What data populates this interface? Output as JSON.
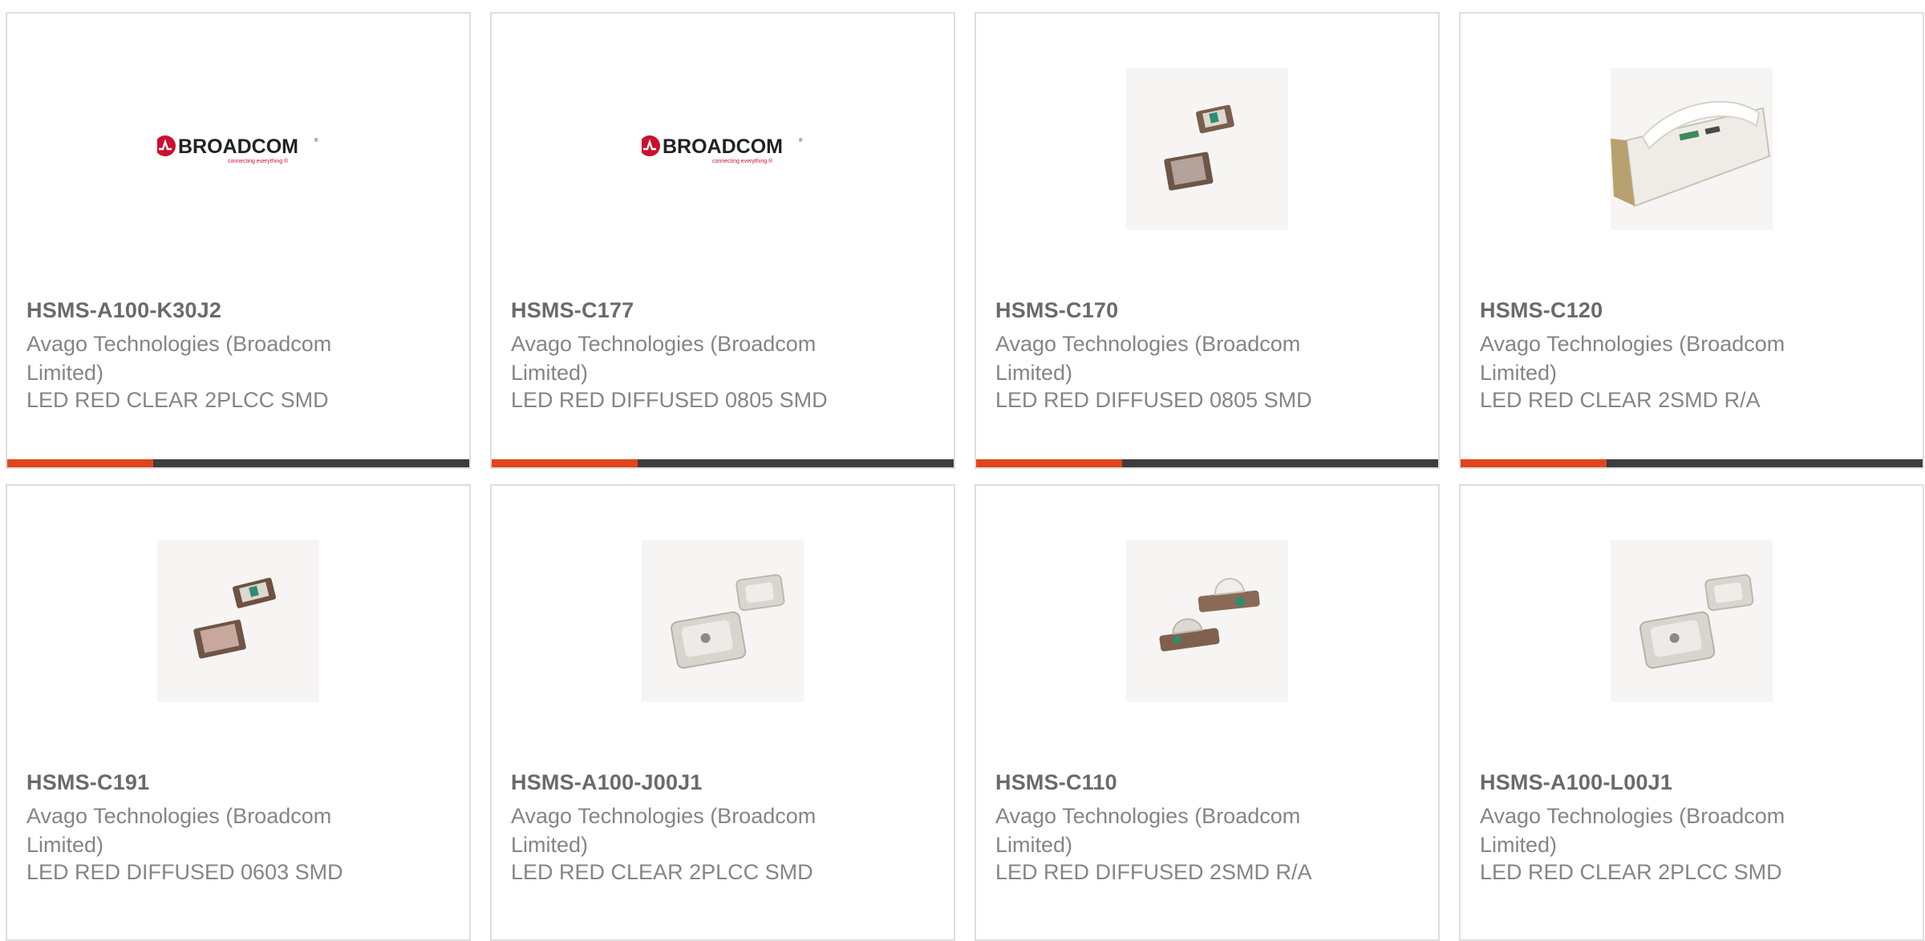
{
  "colors": {
    "accent": "#e1451c",
    "bar_dark": "#3d3d3d",
    "title": "#6a6a6a",
    "text": "#858585",
    "border": "#dedede",
    "broadcom_red": "#cc0f2f"
  },
  "logo": {
    "name": "BROADCOM",
    "trademark": "®",
    "tagline": "connecting everything ®"
  },
  "products": [
    {
      "part": "HSMS-A100-K30J2",
      "manufacturer": "Avago Technologies (Broadcom Limited)",
      "description": "LED RED CLEAR 2PLCC SMD",
      "image": "broadcom-logo"
    },
    {
      "part": "HSMS-C177",
      "manufacturer": "Avago Technologies (Broadcom Limited)",
      "description": "LED RED DIFFUSED 0805 SMD",
      "image": "broadcom-logo"
    },
    {
      "part": "HSMS-C170",
      "manufacturer": "Avago Technologies (Broadcom Limited)",
      "description": "LED RED DIFFUSED 0805 SMD",
      "image": "smd-led-0805-photo"
    },
    {
      "part": "HSMS-C120",
      "manufacturer": "Avago Technologies (Broadcom Limited)",
      "description": "LED RED CLEAR 2SMD R/A",
      "image": "right-angle-led-photo"
    },
    {
      "part": "HSMS-C191",
      "manufacturer": "Avago Technologies (Broadcom Limited)",
      "description": "LED RED DIFFUSED 0603 SMD",
      "image": "smd-led-0603-photo"
    },
    {
      "part": "HSMS-A100-J00J1",
      "manufacturer": "Avago Technologies (Broadcom Limited)",
      "description": "LED RED CLEAR 2PLCC SMD",
      "image": "plcc-led-photo"
    },
    {
      "part": "HSMS-C110",
      "manufacturer": "Avago Technologies (Broadcom Limited)",
      "description": "LED RED DIFFUSED 2SMD R/A",
      "image": "dome-led-photo"
    },
    {
      "part": "HSMS-A100-L00J1",
      "manufacturer": "Avago Technologies (Broadcom Limited)",
      "description": "LED RED CLEAR 2PLCC SMD",
      "image": "plcc-led-photo"
    }
  ]
}
